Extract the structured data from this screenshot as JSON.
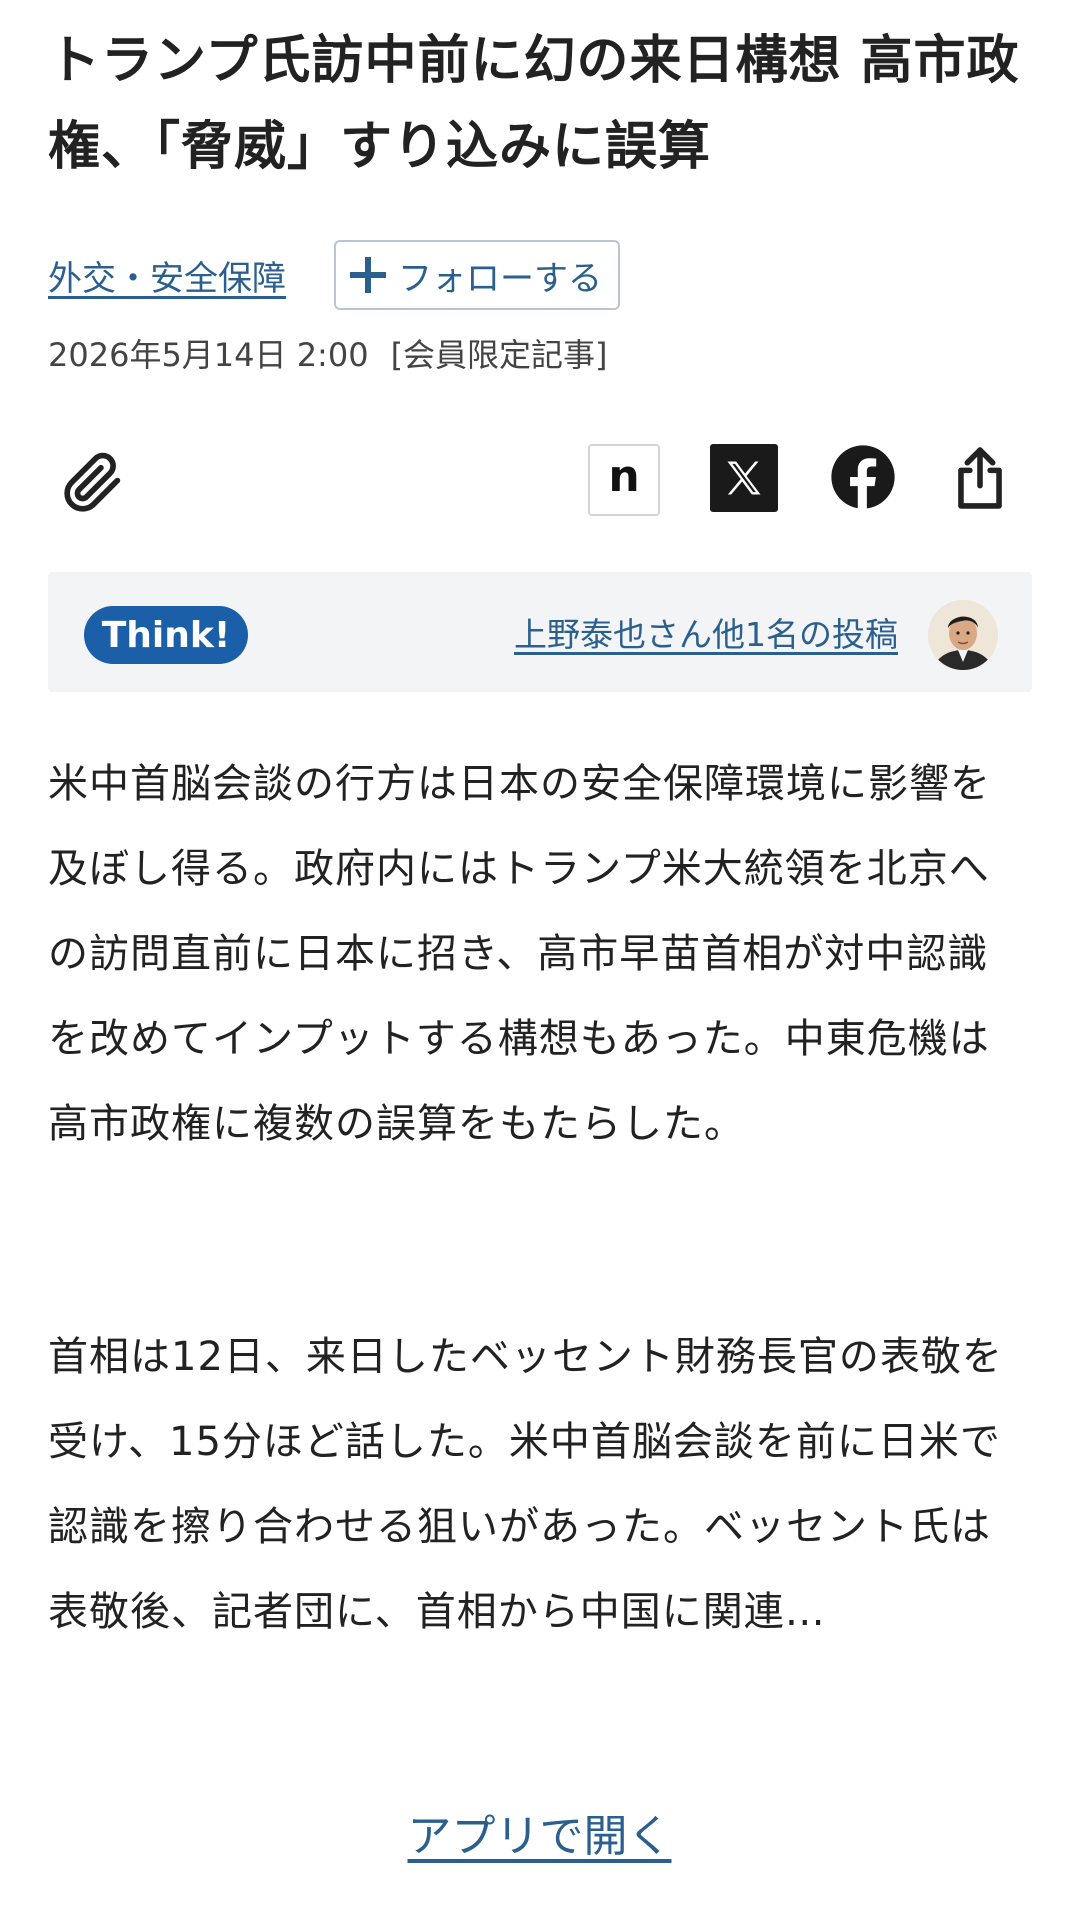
{
  "article": {
    "title": "トランプ氏訪中前に幻の来日構想 高市政権、「脅威」すり込みに誤算",
    "topic": "外交・安全保障",
    "follow_label": "フォローする",
    "date": "2026年5月14日 2:00",
    "badge": "[会員限定記事]",
    "paragraphs": [
      "米中首脳会談の行方は日本の安全保障環境に影響を及ぼし得る。政府内にはトランプ米大統領を北京への訪問直前に日本に招き、高市早苗首相が対中認識を改めてインプットする構想もあった。中東危機は高市政権に複数の誤算をもたらした。",
      "首相は12日、来日したベッセント財務長官の表敬を受け、15分ほど話した。米中首脳会談を前に日米で認識を擦り合わせる狙いがあった。ベッセント氏は表敬後、記者団に、首相から中国に関連…"
    ]
  },
  "share": {
    "icons": [
      "paperclip-icon",
      "note-icon",
      "x-icon",
      "facebook-icon",
      "share-icon"
    ],
    "note_glyph": "n"
  },
  "think": {
    "label": "Think!",
    "poster_text": "上野泰也さん他1名の投稿"
  },
  "footer": {
    "open_app": "アプリで開く"
  },
  "colors": {
    "link": "#2b5f8e",
    "think_pill": "#1b5fa8",
    "think_bg": "#f3f4f5",
    "text": "#222222"
  }
}
